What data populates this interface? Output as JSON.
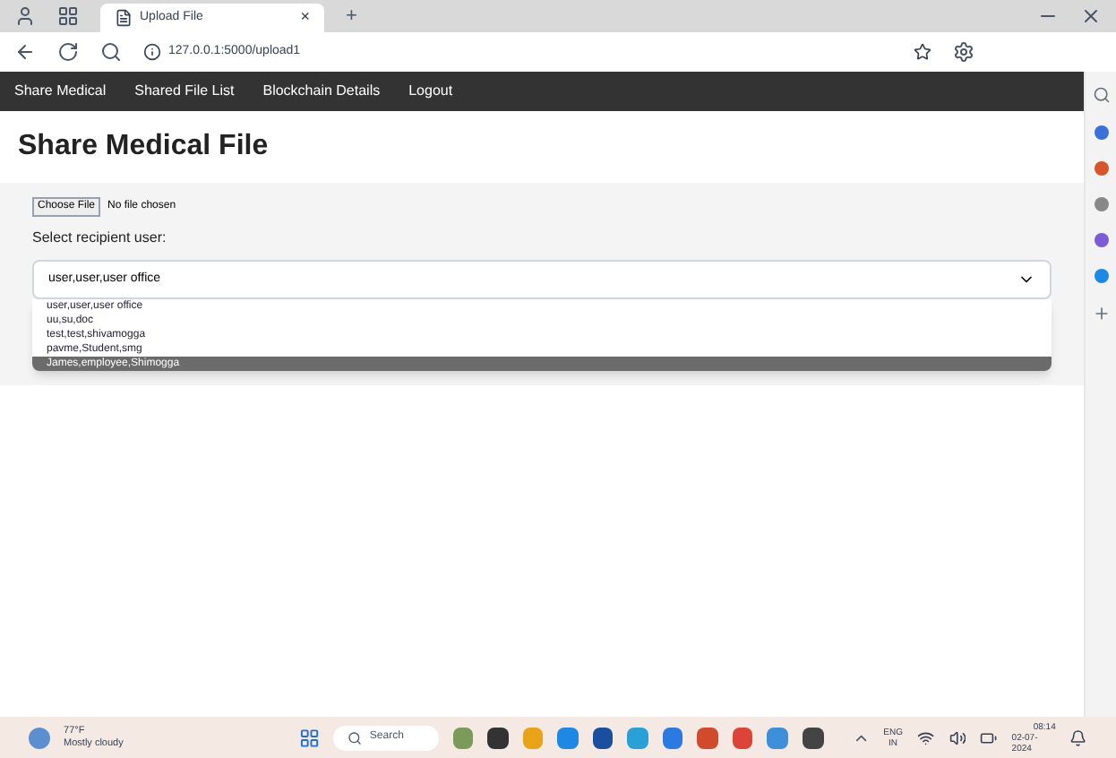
{
  "browser": {
    "tab_title": "Upload File",
    "tab_close": "×",
    "new_tab": "+",
    "url": "127.0.0.1:5000/upload1"
  },
  "nav": {
    "items": [
      {
        "label": "Share Medical"
      },
      {
        "label": "Shared File List"
      },
      {
        "label": "Blockchain Details"
      },
      {
        "label": "Logout"
      }
    ]
  },
  "page": {
    "heading": "Share Medical File",
    "file_button": "Choose File",
    "file_status": "No file chosen",
    "recipient_label": "Select recipient user:",
    "select_value": "user,user,user office",
    "options": [
      {
        "label": "user,user,user office",
        "selected": false
      },
      {
        "label": "uu,su,doc",
        "selected": false
      },
      {
        "label": "test,test,shivamogga",
        "selected": false
      },
      {
        "label": "pavme,Student,smg",
        "selected": false
      },
      {
        "label": "James,employee,Shimogga",
        "selected": true
      }
    ]
  },
  "taskbar": {
    "temperature": "77°F",
    "weather": "Mostly cloudy",
    "search_placeholder": "Search",
    "language": "ENG",
    "region": "IN",
    "time": "08:14",
    "date": "02-07-2024"
  }
}
